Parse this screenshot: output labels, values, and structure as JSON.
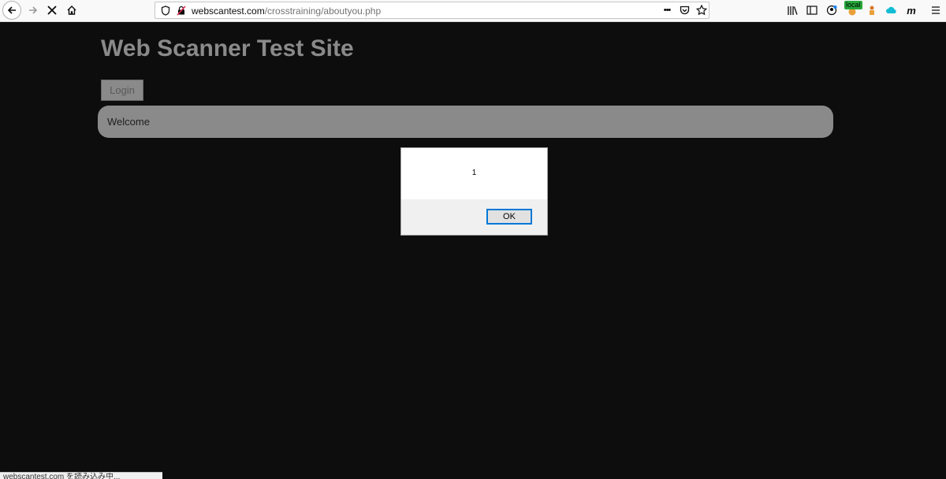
{
  "browser": {
    "url_domain": "webscantest.com",
    "url_path": "/crosstraining/aboutyou.php",
    "more_label": "•••",
    "ext_badge": "local",
    "ext_m_label": "m"
  },
  "page": {
    "title": "Web Scanner Test Site",
    "login_label": "Login",
    "welcome_text": "Welcome"
  },
  "dialog": {
    "message": "1",
    "ok_label": "OK"
  },
  "status": {
    "text": "webscantest.com を読み込み中..."
  }
}
